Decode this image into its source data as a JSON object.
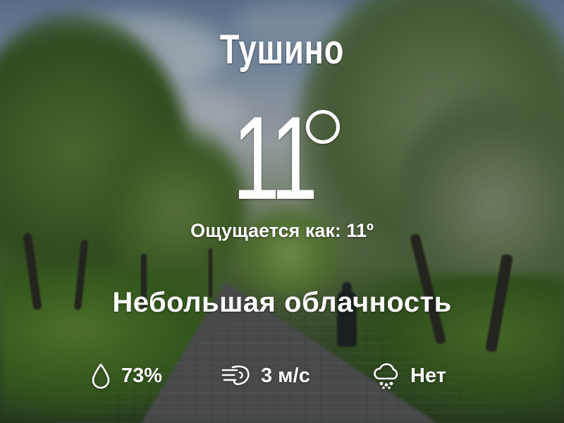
{
  "location": {
    "city": "Тушино"
  },
  "current": {
    "temperature": "11",
    "feels_like": "Ощущается как: 11º",
    "condition": "Небольшая облачность"
  },
  "stats": {
    "humidity": {
      "icon": "droplet-icon",
      "value": "73%"
    },
    "wind": {
      "icon": "wind-icon",
      "value": "3 м/с"
    },
    "precipitation": {
      "icon": "rain-cloud-icon",
      "value": "Нет"
    }
  },
  "colors": {
    "text": "#ffffff"
  }
}
